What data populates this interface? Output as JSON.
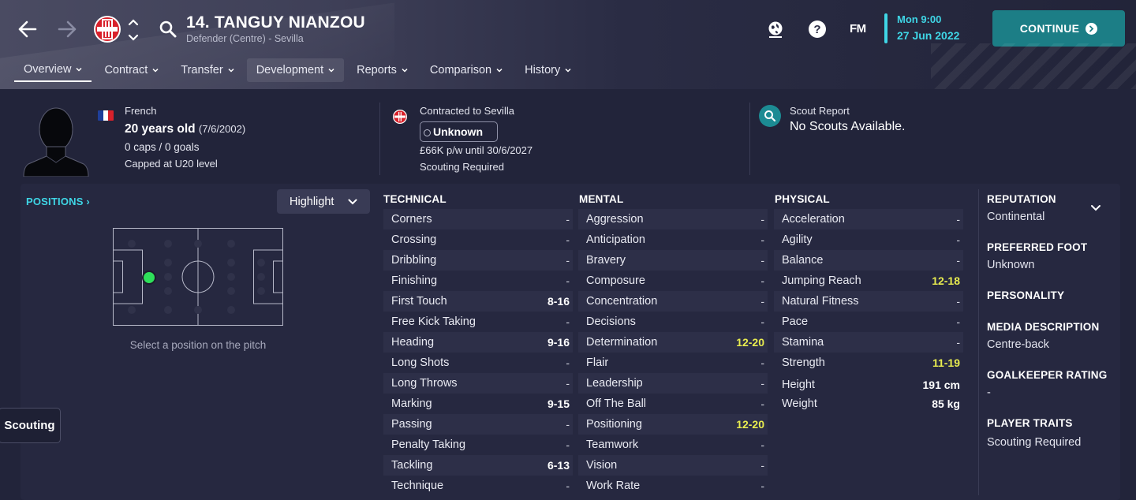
{
  "header": {
    "player_name": "14. TANGUY NIANZOU",
    "player_sub": "Defender (Centre) - Sevilla",
    "fm_logo": "FM",
    "date_time": "Mon 9:00",
    "date_day": "27 Jun 2022",
    "continue_label": "CONTINUE",
    "icons": [
      "back-arrow-icon",
      "forward-arrow-icon",
      "club-crest-icon",
      "up-down-chevron-icon",
      "search-icon",
      "globe-icon",
      "help-icon",
      "continue-arrow-icon"
    ],
    "accent_color": "#3fd6e6",
    "continue_color": "#1c7e86"
  },
  "tabs": [
    {
      "label": "Overview"
    },
    {
      "label": "Contract"
    },
    {
      "label": "Transfer"
    },
    {
      "label": "Development"
    },
    {
      "label": "Reports"
    },
    {
      "label": "Comparison"
    },
    {
      "label": "History"
    }
  ],
  "info": {
    "nationality": "French",
    "age": "20 years old",
    "dob": "(7/6/2002)",
    "caps": "0 caps / 0 goals",
    "capped": "Capped at U20 level",
    "contract_title": "Contracted to Sevilla",
    "status": "Unknown",
    "wage": "£66K p/w until 30/6/2027",
    "scouting": "Scouting Required",
    "scout_label": "Scout Report",
    "scout_value": "No Scouts Available."
  },
  "positions": {
    "title": "POSITIONS",
    "highlight_label": "Highlight",
    "caption": "Select a position on the pitch",
    "marker_color": "#2ee05a"
  },
  "scouting_tab": "Scouting",
  "technical": {
    "title": "TECHNICAL",
    "rows": [
      {
        "name": "Corners",
        "value": "-"
      },
      {
        "name": "Crossing",
        "value": "-"
      },
      {
        "name": "Dribbling",
        "value": "-"
      },
      {
        "name": "Finishing",
        "value": "-"
      },
      {
        "name": "First Touch",
        "value": "8-16"
      },
      {
        "name": "Free Kick Taking",
        "value": "-"
      },
      {
        "name": "Heading",
        "value": "9-16"
      },
      {
        "name": "Long Shots",
        "value": "-"
      },
      {
        "name": "Long Throws",
        "value": "-"
      },
      {
        "name": "Marking",
        "value": "9-15"
      },
      {
        "name": "Passing",
        "value": "-"
      },
      {
        "name": "Penalty Taking",
        "value": "-"
      },
      {
        "name": "Tackling",
        "value": "6-13"
      },
      {
        "name": "Technique",
        "value": "-"
      }
    ]
  },
  "mental": {
    "title": "MENTAL",
    "rows": [
      {
        "name": "Aggression",
        "value": "-"
      },
      {
        "name": "Anticipation",
        "value": "-"
      },
      {
        "name": "Bravery",
        "value": "-"
      },
      {
        "name": "Composure",
        "value": "-"
      },
      {
        "name": "Concentration",
        "value": "-"
      },
      {
        "name": "Decisions",
        "value": "-"
      },
      {
        "name": "Determination",
        "value": "12-20"
      },
      {
        "name": "Flair",
        "value": "-"
      },
      {
        "name": "Leadership",
        "value": "-"
      },
      {
        "name": "Off The Ball",
        "value": "-"
      },
      {
        "name": "Positioning",
        "value": "12-20"
      },
      {
        "name": "Teamwork",
        "value": "-"
      },
      {
        "name": "Vision",
        "value": "-"
      },
      {
        "name": "Work Rate",
        "value": "-"
      }
    ]
  },
  "physical": {
    "title": "PHYSICAL",
    "rows": [
      {
        "name": "Acceleration",
        "value": "-"
      },
      {
        "name": "Agility",
        "value": "-"
      },
      {
        "name": "Balance",
        "value": "-"
      },
      {
        "name": "Jumping Reach",
        "value": "12-18"
      },
      {
        "name": "Natural Fitness",
        "value": "-"
      },
      {
        "name": "Pace",
        "value": "-"
      },
      {
        "name": "Stamina",
        "value": "-"
      },
      {
        "name": "Strength",
        "value": "11-19"
      }
    ],
    "height_label": "Height",
    "height_value": "191 cm",
    "weight_label": "Weight",
    "weight_value": "85 kg"
  },
  "profile": {
    "reputation_title": "REPUTATION",
    "reputation_value": "Continental",
    "foot_title": "PREFERRED FOOT",
    "foot_value": "Unknown",
    "personality_title": "PERSONALITY",
    "media_title": "MEDIA DESCRIPTION",
    "media_value": "Centre-back",
    "gk_title": "GOALKEEPER RATING",
    "gk_value": "-",
    "traits_title": "PLAYER TRAITS",
    "traits_value": "Scouting Required"
  }
}
